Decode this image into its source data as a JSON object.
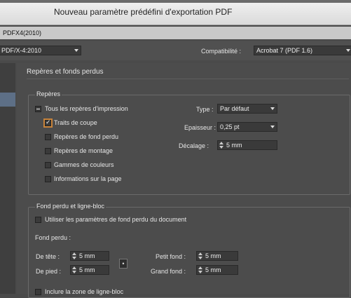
{
  "window": {
    "title": "Nouveau paramètre prédéfini d'exportation PDF"
  },
  "preset": {
    "name": "PDFX4(2010)"
  },
  "standard": {
    "value": "PDF/X-4:2010",
    "compat_label": "Compatibilité :",
    "compat_value": "Acrobat 7 (PDF 1.6)"
  },
  "section": {
    "title": "Repères et fonds perdus"
  },
  "marks": {
    "legend": "Repères",
    "all_marks": "Tous les repères d'impression",
    "trim_marks": "Traits de coupe",
    "bleed_marks": "Repères de fond perdu",
    "registration_marks": "Repères de montage",
    "color_bars": "Gammes de couleurs",
    "page_info": "Informations sur la page",
    "type_label": "Type :",
    "type_value": "Par défaut",
    "weight_label": "Epaisseur :",
    "weight_value": "0,25 pt",
    "offset_label": "Décalage :",
    "offset_value": "5 mm",
    "checked": {
      "all_marks": "partial",
      "trim_marks": true,
      "bleed_marks": false,
      "registration_marks": false,
      "color_bars": false,
      "page_info": false
    }
  },
  "bleed": {
    "legend": "Fond perdu et ligne-bloc",
    "use_doc_bleed": "Utiliser les paramètres de fond perdu du document",
    "use_doc_bleed_checked": false,
    "sublabel": "Fond perdu :",
    "top_label": "De tête :",
    "top_value": "5 mm",
    "bottom_label": "De pied :",
    "bottom_value": "5 mm",
    "inside_label": "Petit fond :",
    "inside_value": "5 mm",
    "outside_label": "Grand fond :",
    "outside_value": "5 mm",
    "include_slug": "Inclure la zone de ligne-bloc",
    "include_slug_checked": false
  }
}
